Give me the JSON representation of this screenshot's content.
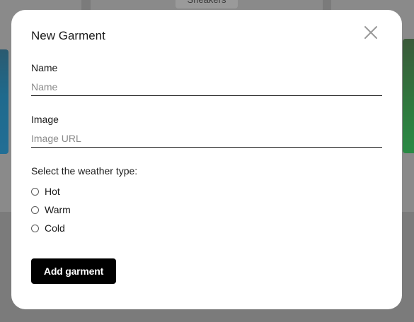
{
  "background": {
    "chip_label": "Sneakers"
  },
  "modal": {
    "title": "New Garment",
    "close_icon": "close-icon",
    "name_label": "Name",
    "name_placeholder": "Name",
    "name_value": "",
    "image_label": "Image",
    "image_placeholder": "Image URL",
    "image_value": "",
    "weather_label": "Select the weather type:",
    "weather_options": [
      {
        "label": "Hot",
        "selected": false
      },
      {
        "label": "Warm",
        "selected": false
      },
      {
        "label": "Cold",
        "selected": false
      }
    ],
    "submit_label": "Add garment"
  },
  "colors": {
    "overlay": "#7b7b7b",
    "button_bg": "#000000",
    "button_text": "#ffffff"
  }
}
